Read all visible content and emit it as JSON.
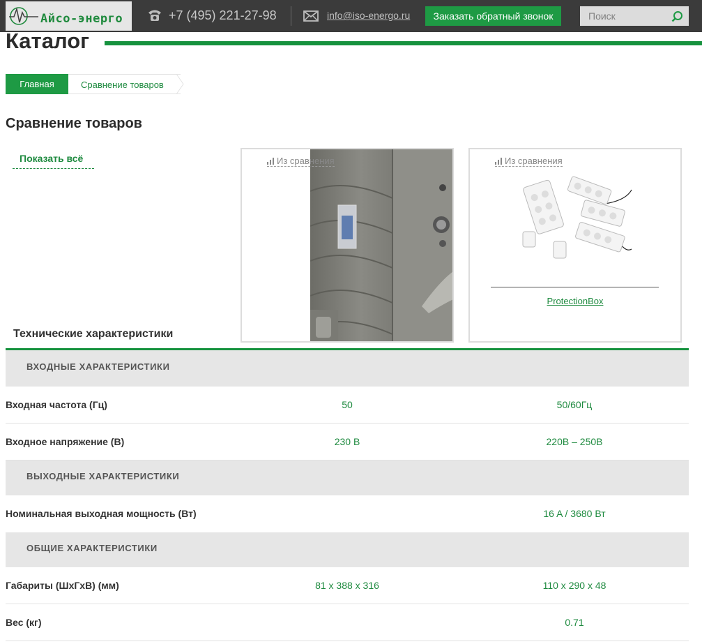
{
  "header": {
    "logo_text": "Айсо-энерго",
    "phone": "+7 (495) 221-27-98",
    "email": "info@iso-energo.ru",
    "callback_label": "Заказать обратный звонок",
    "search_placeholder": "Поиск"
  },
  "catalog_title": "Каталог",
  "breadcrumb": {
    "home": "Главная",
    "current": "Сравнение товаров"
  },
  "page_title": "Сравнение товаров",
  "show_all_label": "Показать всё",
  "tech_title": "Технические характеристики",
  "products": [
    {
      "remove_label": "Из сравнения",
      "name": ""
    },
    {
      "remove_label": "Из сравнения",
      "name": "ProtectionBox"
    }
  ],
  "sections": [
    {
      "title": "ВХОДНЫЕ ХАРАКТЕРИСТИКИ",
      "rows": [
        {
          "label": "Входная частота (Гц)",
          "values": [
            "50",
            "50/60Гц"
          ]
        },
        {
          "label": "Входное напряжение (В)",
          "values": [
            "230 В",
            "220В – 250В"
          ]
        }
      ]
    },
    {
      "title": "ВЫХОДНЫЕ ХАРАКТЕРИСТИКИ",
      "rows": [
        {
          "label": "Номинальная выходная мощность (Вт)",
          "values": [
            "",
            "16 A / 3680 Вт"
          ]
        }
      ]
    },
    {
      "title": "ОБЩИЕ ХАРАКТЕРИСТИКИ",
      "rows": [
        {
          "label": "Габариты (ШхГхВ) (мм)",
          "values": [
            "81 x 388 x 316",
            "110 x 290 x 48"
          ]
        },
        {
          "label": "Вес (кг)",
          "values": [
            "",
            "0.71"
          ]
        }
      ]
    }
  ],
  "colors": {
    "brand_green": "#1e9a44",
    "topbar": "#3b3b3b",
    "section_bg": "#e6e6e6"
  },
  "icons": {
    "phone": "phone-icon",
    "mail": "mail-icon",
    "search": "search-icon",
    "compare": "compare-bars-icon"
  }
}
